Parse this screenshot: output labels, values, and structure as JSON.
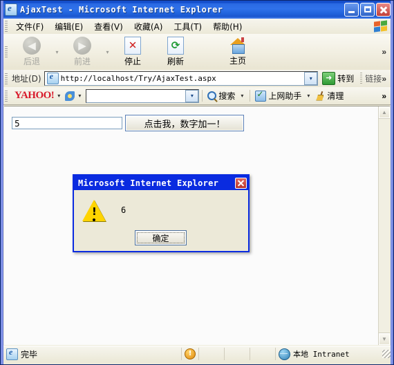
{
  "window": {
    "title": "AjaxTest - Microsoft Internet Explorer",
    "icon": "ie-page-icon",
    "controls": {
      "minimize": "minimize-button",
      "maximize": "maximize-button",
      "close": "close-button"
    }
  },
  "menubar": {
    "items": [
      {
        "label": "文件(F)"
      },
      {
        "label": "编辑(E)"
      },
      {
        "label": "查看(V)"
      },
      {
        "label": "收藏(A)"
      },
      {
        "label": "工具(T)"
      },
      {
        "label": "帮助(H)"
      }
    ],
    "logo": "windows-flag-icon"
  },
  "toolbar": {
    "back_label": "后退",
    "forward_label": "前进",
    "stop_label": "停止",
    "refresh_label": "刷新",
    "home_label": "主页",
    "overflow_label": "»"
  },
  "addressbar": {
    "label": "地址(D)",
    "url": "http://localhost/Try/AjaxTest.aspx",
    "go_label": "转到",
    "links_label": "链接",
    "overflow_label": "»"
  },
  "yahoobar": {
    "logo": "YAHOO!",
    "search_value": "",
    "search_label": "搜索",
    "assistant_label": "上网助手",
    "clean_label": "清理",
    "overflow_label": "»",
    "caret": "▾"
  },
  "page": {
    "textbox_value": "5",
    "button_label": "点击我，数字加一！"
  },
  "scrollbar": {
    "up_arrow": "▲",
    "down_arrow": "▼"
  },
  "dialog": {
    "title": "Microsoft Internet Explorer",
    "message": "6",
    "ok_label": "确定",
    "icon": "warning-icon",
    "close": "close-button"
  },
  "statusbar": {
    "status_text": "完毕",
    "zone_text": "本地 Intranet",
    "warn_glyph": "!"
  },
  "colors": {
    "title_blue": "#2f71ea",
    "dialog_blue": "#0a2be0",
    "chrome_beige": "#ece9d8",
    "yahoo_red": "#d8192a",
    "warning_yellow": "#ffd400"
  }
}
